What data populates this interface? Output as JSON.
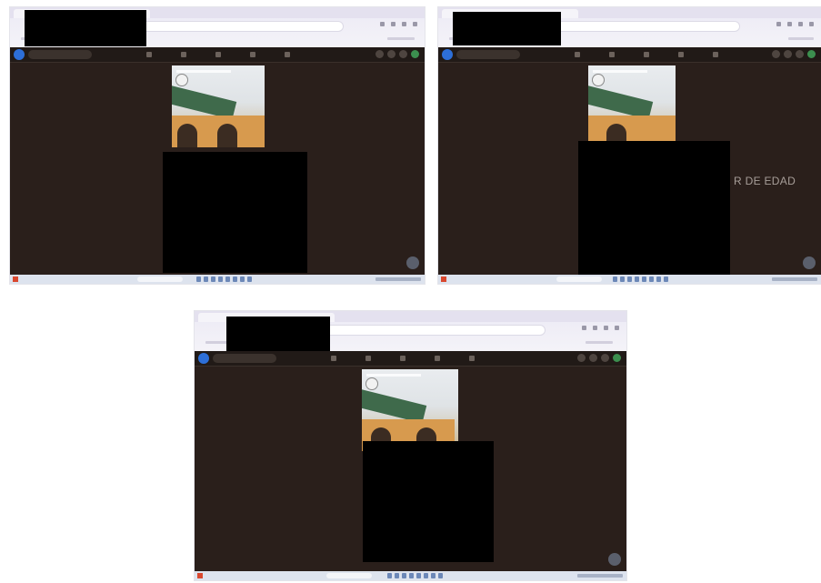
{
  "screenshots": [
    {
      "id": "shot-1",
      "overlay_text": ""
    },
    {
      "id": "shot-2",
      "overlay_text": "R DE EDAD"
    },
    {
      "id": "shot-3",
      "overlay_text": ""
    }
  ],
  "icons": [
    "facebook-logo-icon",
    "search-icon",
    "home-icon",
    "video-icon",
    "marketplace-icon",
    "groups-icon",
    "gaming-icon",
    "menu-icon",
    "messenger-icon",
    "notification-icon",
    "avatar",
    "chat-icon",
    "windows-start-icon"
  ],
  "colors": {
    "app_background": "#2a1f1b",
    "redaction": "#000000",
    "browser_chrome": "#eceaf5",
    "taskbar": "#dde3ee",
    "facebook_blue": "#2d6fd8"
  }
}
